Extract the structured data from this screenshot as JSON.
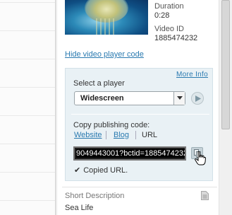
{
  "video": {
    "duration_label": "Duration",
    "duration_value": "0:28",
    "id_label": "Video ID",
    "id_value": "1885474232"
  },
  "links": {
    "hide_player_code": "Hide video player code",
    "more_info": "More Info"
  },
  "player": {
    "select_label": "Select a player",
    "selected": "Widescreen"
  },
  "publishing": {
    "label": "Copy publishing code:",
    "tabs": [
      "Website",
      "Blog",
      "URL"
    ],
    "active_tab": "URL",
    "code_value": "9049443001?bctid=1885474232",
    "copied_message": "Copied URL."
  },
  "short_description": {
    "label": "Short Description",
    "value": "Sea Life"
  },
  "icons": {
    "play": "play-icon",
    "copy": "copy-icon",
    "check": "check-icon",
    "document": "document-icon",
    "cursor": "hand-cursor-icon"
  },
  "colors": {
    "link": "#2a7ab0",
    "panel_bg": "#e9f1f5",
    "code_bg": "#1c1c1c"
  }
}
